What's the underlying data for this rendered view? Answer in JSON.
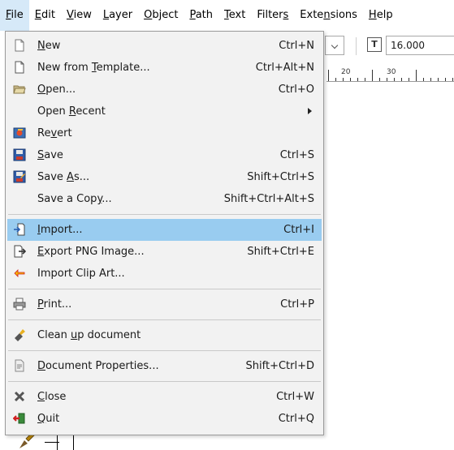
{
  "menubar": [
    {
      "pre": "",
      "mn": "F",
      "post": "ile",
      "active": true
    },
    {
      "pre": "",
      "mn": "E",
      "post": "dit"
    },
    {
      "pre": "",
      "mn": "V",
      "post": "iew"
    },
    {
      "pre": "",
      "mn": "L",
      "post": "ayer"
    },
    {
      "pre": "",
      "mn": "O",
      "post": "bject"
    },
    {
      "pre": "",
      "mn": "P",
      "post": "ath"
    },
    {
      "pre": "",
      "mn": "T",
      "post": "ext"
    },
    {
      "pre": "Filter",
      "mn": "s",
      "post": ""
    },
    {
      "pre": "Exte",
      "mn": "n",
      "post": "sions"
    },
    {
      "pre": "",
      "mn": "H",
      "post": "elp"
    }
  ],
  "toolbar": {
    "font_icon": "T",
    "font_size": "16.000"
  },
  "ruler": {
    "labels": [
      "20",
      "30"
    ]
  },
  "file_menu": {
    "items": [
      {
        "pre": "",
        "mn": "N",
        "post": "ew",
        "accel": "Ctrl+N",
        "icon": "new-document-icon"
      },
      {
        "pre": "New from ",
        "mn": "T",
        "post": "emplate...",
        "accel": "Ctrl+Alt+N",
        "icon": "template-icon"
      },
      {
        "pre": "",
        "mn": "O",
        "post": "pen...",
        "accel": "Ctrl+O",
        "icon": "folder-open-icon"
      },
      {
        "pre": "Open ",
        "mn": "R",
        "post": "ecent",
        "accel": "",
        "submenu": true,
        "icon": ""
      },
      {
        "pre": "Re",
        "mn": "v",
        "post": "ert",
        "accel": "",
        "icon": "revert-icon"
      },
      {
        "pre": "",
        "mn": "S",
        "post": "ave",
        "accel": "Ctrl+S",
        "icon": "save-icon"
      },
      {
        "pre": "Save ",
        "mn": "A",
        "post": "s...",
        "accel": "Shift+Ctrl+S",
        "icon": "save-as-icon"
      },
      {
        "pre": "Save a Cop",
        "mn": "y",
        "post": "...",
        "accel": "Shift+Ctrl+Alt+S",
        "icon": ""
      },
      {
        "sep": true
      },
      {
        "pre": "",
        "mn": "I",
        "post": "mport...",
        "accel": "Ctrl+I",
        "icon": "import-icon",
        "highlighted": true
      },
      {
        "pre": "",
        "mn": "E",
        "post": "xport PNG Image...",
        "accel": "Shift+Ctrl+E",
        "icon": "export-icon"
      },
      {
        "pre": "Import Clip Art...",
        "mn": "",
        "post": "",
        "accel": "",
        "icon": "clip-art-icon"
      },
      {
        "sep": true
      },
      {
        "pre": "",
        "mn": "P",
        "post": "rint...",
        "accel": "Ctrl+P",
        "icon": "print-icon"
      },
      {
        "sep": true
      },
      {
        "pre": "Clean ",
        "mn": "u",
        "post": "p document",
        "accel": "",
        "icon": "cleanup-icon"
      },
      {
        "sep": true
      },
      {
        "pre": "",
        "mn": "D",
        "post": "ocument Properties...",
        "accel": "Shift+Ctrl+D",
        "icon": "document-properties-icon"
      },
      {
        "sep": true
      },
      {
        "pre": "",
        "mn": "C",
        "post": "lose",
        "accel": "Ctrl+W",
        "icon": "close-icon"
      },
      {
        "pre": "",
        "mn": "Q",
        "post": "uit",
        "accel": "Ctrl+Q",
        "icon": "quit-icon"
      }
    ]
  }
}
